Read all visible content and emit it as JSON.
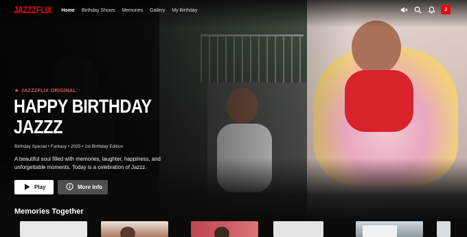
{
  "brand": {
    "logo": "JAZZZFLIX",
    "color": "#e50914"
  },
  "nav": {
    "links": [
      "Home",
      "Birthday Shows",
      "Memories",
      "Gallery",
      "My Birthday"
    ],
    "active": "Home",
    "icons": [
      "volume-mute-icon",
      "search-icon",
      "bell-icon"
    ],
    "avatar_initial": "J"
  },
  "hero": {
    "badge": "JAZZZFLIX ORIGINAL",
    "title_line1": "HAPPY BIRTHDAY",
    "title_line2": "JAZZZ",
    "meta": "Birthday Special • Fantasy • 2025 • 1st Birthday Edition",
    "description": "A beautiful soul filled with memories, laughter, happiness, and unforgettable moments. Today is a celebration of Jazzz.",
    "play_label": "Play",
    "info_label": "More Info"
  },
  "row": {
    "title": "Memories Together",
    "thumbs": [
      "thumb-1",
      "thumb-2",
      "thumb-3",
      "thumb-4",
      "thumb-5",
      "thumb-6"
    ]
  }
}
